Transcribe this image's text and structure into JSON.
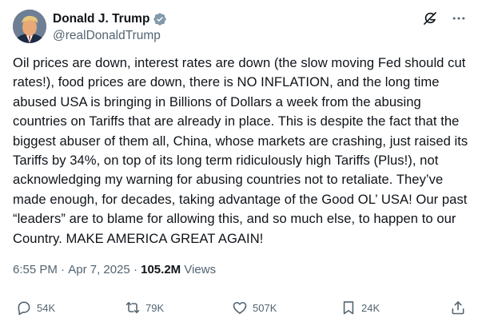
{
  "author": {
    "name": "Donald J. Trump",
    "handle": "@realDonaldTrump",
    "verified": true,
    "verified_color": "#829aab"
  },
  "tweet": {
    "text": "Oil prices are down, interest rates are down (the slow moving Fed should cut rates!), food prices are down, there is NO INFLATION, and the long time abused USA is bringing in Billions of Dollars a week from the abusing countries on Tariffs that are already in place. This is despite the fact that the biggest abuser of them all, China, whose markets are crashing, just raised its Tariffs by 34%, on top of its long term ridiculously high Tariffs (Plus!), not acknowledging my warning for abusing countries not to retaliate. They’ve made enough, for decades, taking advantage of the Good OL’ USA! Our past “leaders” are to blame for allowing this, and so much else, to happen to our Country. MAKE AMERICA GREAT AGAIN!"
  },
  "meta": {
    "time": "6:55 PM",
    "separator1": " · ",
    "date": "Apr 7, 2025",
    "separator2": " · ",
    "views_count": "105.2M",
    "views_label": " Views"
  },
  "actions": {
    "replies": "54K",
    "reposts": "79K",
    "likes": "507K",
    "bookmarks": "24K"
  },
  "icons": {
    "grok": "grok-icon",
    "more": "more-icon",
    "reply": "reply-icon",
    "repost": "repost-icon",
    "like": "like-icon",
    "bookmark": "bookmark-icon",
    "share": "share-icon"
  },
  "colors": {
    "text": "#0f1419",
    "secondary": "#536471"
  }
}
